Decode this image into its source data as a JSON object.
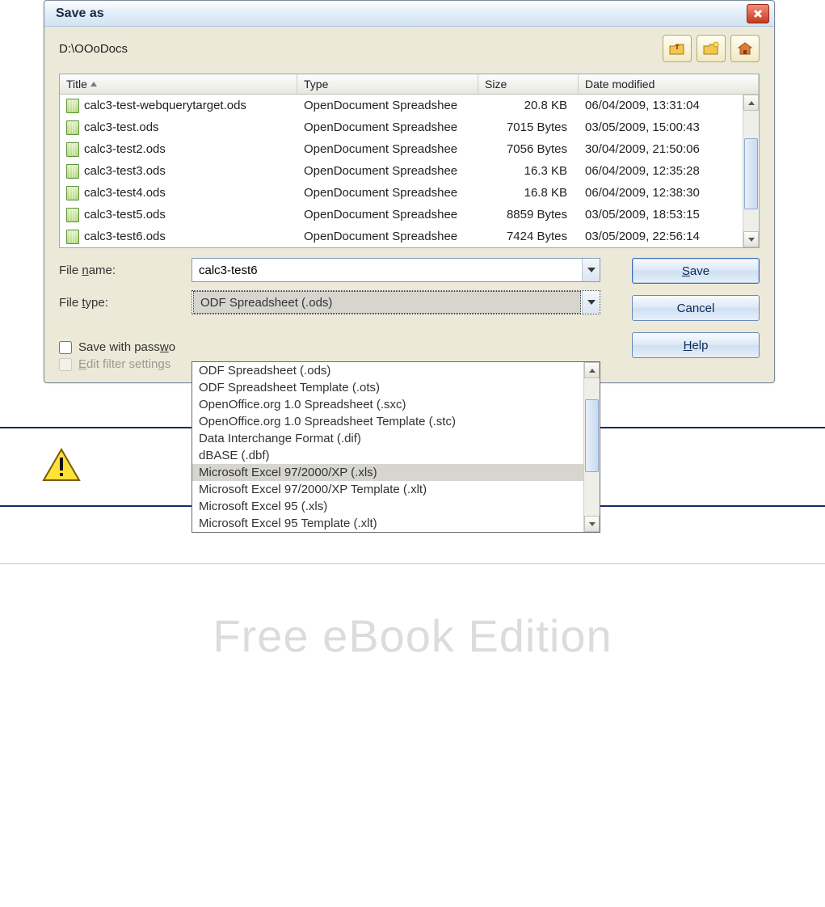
{
  "dialog": {
    "title": "Save as",
    "path": "D:\\OOoDocs",
    "columns": {
      "title": "Title",
      "type": "Type",
      "size": "Size",
      "date": "Date modified"
    },
    "rows": [
      {
        "name": "calc3-test-webquerytarget.ods",
        "type": "OpenDocument Spreadshee",
        "size": "20.8 KB",
        "date": "06/04/2009, 13:31:04"
      },
      {
        "name": "calc3-test.ods",
        "type": "OpenDocument Spreadshee",
        "size": "7015 Bytes",
        "date": "03/05/2009, 15:00:43"
      },
      {
        "name": "calc3-test2.ods",
        "type": "OpenDocument Spreadshee",
        "size": "7056 Bytes",
        "date": "30/04/2009, 21:50:06"
      },
      {
        "name": "calc3-test3.ods",
        "type": "OpenDocument Spreadshee",
        "size": "16.3 KB",
        "date": "06/04/2009, 12:35:28"
      },
      {
        "name": "calc3-test4.ods",
        "type": "OpenDocument Spreadshee",
        "size": "16.8 KB",
        "date": "06/04/2009, 12:38:30"
      },
      {
        "name": "calc3-test5.ods",
        "type": "OpenDocument Spreadshee",
        "size": "8859 Bytes",
        "date": "03/05/2009, 18:53:15"
      },
      {
        "name": "calc3-test6.ods",
        "type": "OpenDocument Spreadshee",
        "size": "7424 Bytes",
        "date": "03/05/2009, 22:56:14"
      }
    ],
    "filename_label": "File name:",
    "filename_value": "calc3-test6",
    "filetype_label": "File type:",
    "filetype_selected": "ODF Spreadsheet (.ods)",
    "filetype_options": [
      "ODF Spreadsheet (.ods)",
      "ODF Spreadsheet Template (.ots)",
      "OpenOffice.org 1.0 Spreadsheet (.sxc)",
      "OpenOffice.org 1.0 Spreadsheet Template (.stc)",
      "Data Interchange Format (.dif)",
      "dBASE (.dbf)",
      "Microsoft Excel 97/2000/XP (.xls)",
      "Microsoft Excel 97/2000/XP Template (.xlt)",
      "Microsoft Excel 95 (.xls)",
      "Microsoft Excel 95 Template (.xlt)"
    ],
    "highlighted_index": 6,
    "save_label": "Save",
    "cancel_label": "Cancel",
    "help_label": "Help",
    "save_password_label": "Save with password",
    "edit_filter_label": "Edit filter settings"
  },
  "watermark": "Free eBook Edition"
}
